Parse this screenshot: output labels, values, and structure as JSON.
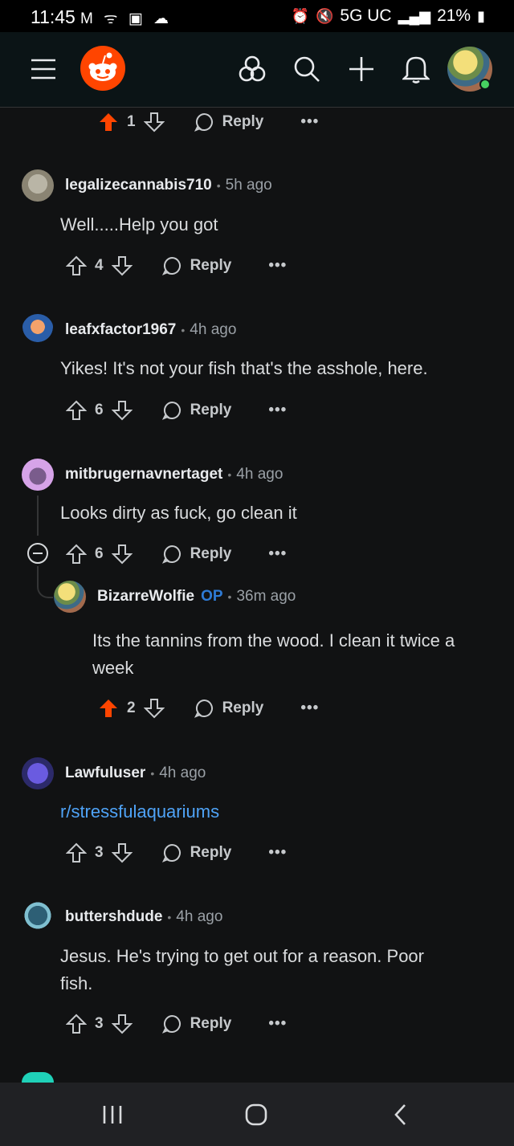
{
  "status_bar": {
    "time": "11:45",
    "left_icons": "M ᯤ ▣ ☁",
    "network": "5G UC",
    "battery": "21%"
  },
  "header": {
    "menu_icon": "hamburger-menu-icon",
    "logo_icon": "reddit-alien-logo",
    "actions": [
      "communities-icon",
      "search-icon",
      "create-post-icon",
      "notifications-icon"
    ],
    "online_color": "#46d160"
  },
  "top_actions": {
    "score": "1",
    "reply": "Reply",
    "more": "•••"
  },
  "comments": [
    {
      "username": "legalizecannabis710",
      "time": "5h ago",
      "body": "Well.....Help you got",
      "score": "4",
      "reply": "Reply",
      "more": "•••"
    },
    {
      "username": "leafxfactor1967",
      "time": "4h ago",
      "body": "Yikes! It's not your fish that's the asshole, here.",
      "score": "6",
      "reply": "Reply",
      "more": "•••"
    },
    {
      "username": "mitbrugernavnertaget",
      "time": "4h ago",
      "body": "Looks dirty as fuck, go clean it",
      "score": "6",
      "reply": "Reply",
      "more": "•••"
    },
    {
      "username": "BizarreWolfie",
      "op": "OP",
      "time": "36m ago",
      "body_line1": "Its the tannins from the wood. I clean it twice a",
      "body_line2": "week",
      "score": "2",
      "reply": "Reply",
      "more": "•••"
    },
    {
      "username": "Lawfuluser",
      "time": "4h ago",
      "body": "r/stressfulaquariums",
      "score": "3",
      "reply": "Reply",
      "more": "•••"
    },
    {
      "username": "buttershdude",
      "time": "4h ago",
      "body_line1": "Jesus. He's trying to get out for a reason. Poor",
      "body_line2": "fish.",
      "score": "3",
      "reply": "Reply",
      "more": "•••"
    }
  ],
  "colors": {
    "upvoted": "#ff4500",
    "link": "#4fa3f7",
    "op": "#2e7bd6",
    "background": "#111213"
  }
}
